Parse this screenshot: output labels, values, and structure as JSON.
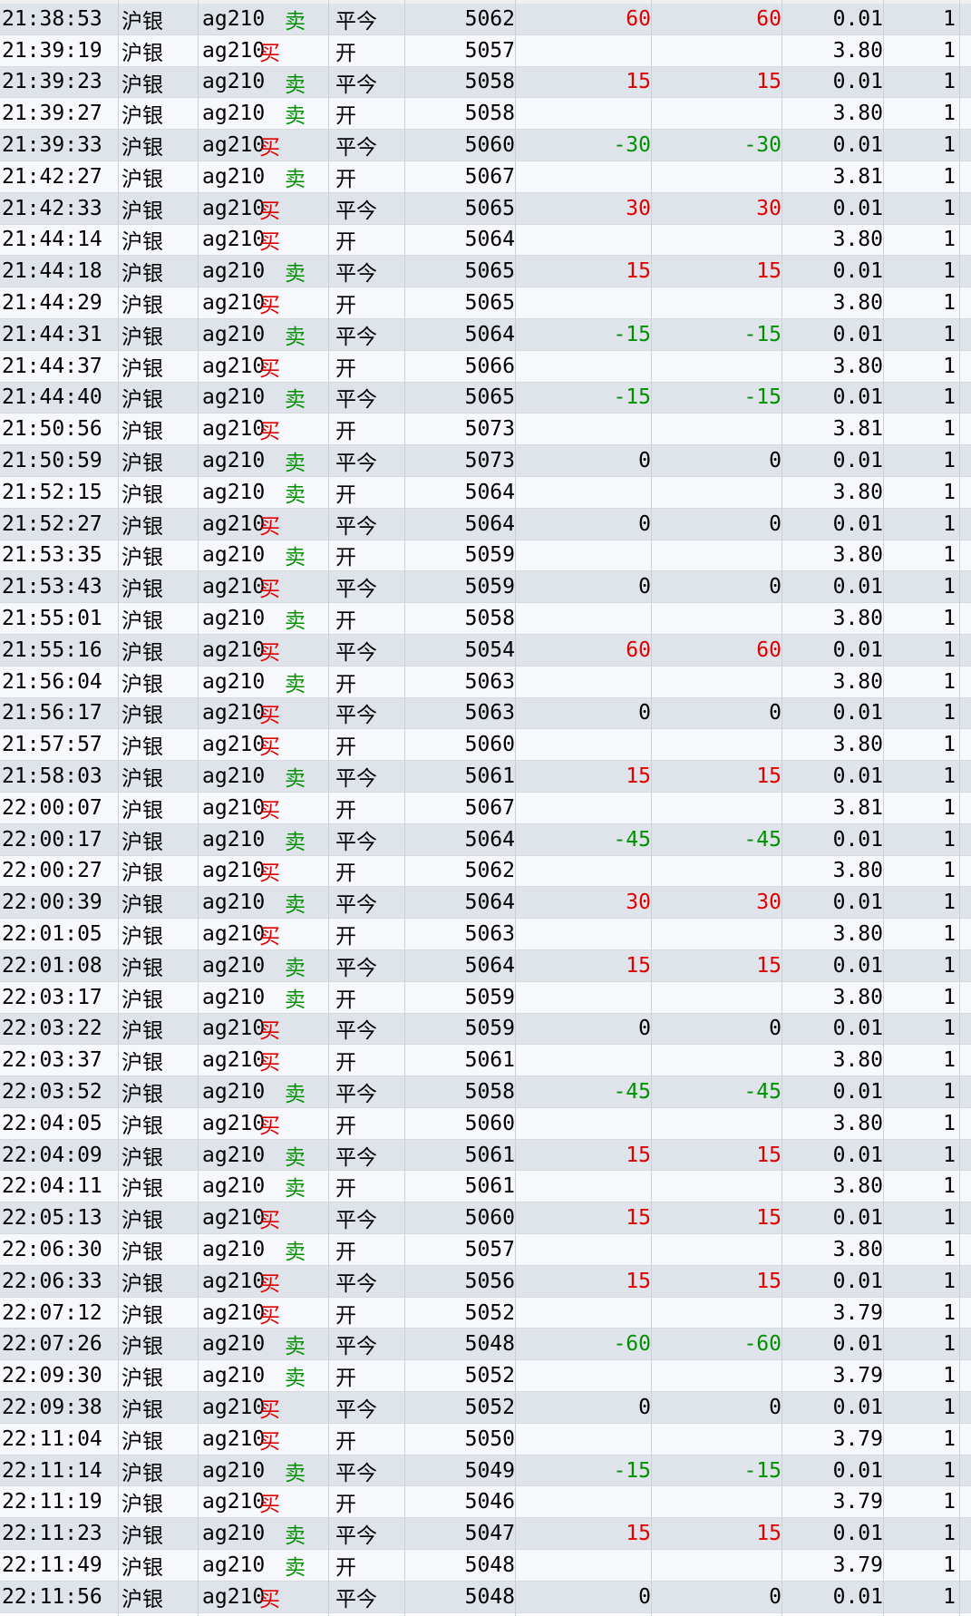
{
  "colors": {
    "buy": "#e00000",
    "sell": "#009000",
    "profit": "#e00000",
    "loss": "#009000"
  },
  "trades": [
    {
      "time": "21:38:53",
      "exchange": "沪银",
      "instrument": "ag210",
      "side": "卖",
      "open_close": "平今",
      "price": "5062",
      "pnl_close": "60",
      "pnl_mark": "60",
      "fee": "0.01",
      "qty": "1"
    },
    {
      "time": "21:39:19",
      "exchange": "沪银",
      "instrument": "ag210",
      "side": "买",
      "open_close": "开",
      "price": "5057",
      "pnl_close": "",
      "pnl_mark": "",
      "fee": "3.80",
      "qty": "1"
    },
    {
      "time": "21:39:23",
      "exchange": "沪银",
      "instrument": "ag210",
      "side": "卖",
      "open_close": "平今",
      "price": "5058",
      "pnl_close": "15",
      "pnl_mark": "15",
      "fee": "0.01",
      "qty": "1"
    },
    {
      "time": "21:39:27",
      "exchange": "沪银",
      "instrument": "ag210",
      "side": "卖",
      "open_close": "开",
      "price": "5058",
      "pnl_close": "",
      "pnl_mark": "",
      "fee": "3.80",
      "qty": "1"
    },
    {
      "time": "21:39:33",
      "exchange": "沪银",
      "instrument": "ag210",
      "side": "买",
      "open_close": "平今",
      "price": "5060",
      "pnl_close": "-30",
      "pnl_mark": "-30",
      "fee": "0.01",
      "qty": "1"
    },
    {
      "time": "21:42:27",
      "exchange": "沪银",
      "instrument": "ag210",
      "side": "卖",
      "open_close": "开",
      "price": "5067",
      "pnl_close": "",
      "pnl_mark": "",
      "fee": "3.81",
      "qty": "1"
    },
    {
      "time": "21:42:33",
      "exchange": "沪银",
      "instrument": "ag210",
      "side": "买",
      "open_close": "平今",
      "price": "5065",
      "pnl_close": "30",
      "pnl_mark": "30",
      "fee": "0.01",
      "qty": "1"
    },
    {
      "time": "21:44:14",
      "exchange": "沪银",
      "instrument": "ag210",
      "side": "买",
      "open_close": "开",
      "price": "5064",
      "pnl_close": "",
      "pnl_mark": "",
      "fee": "3.80",
      "qty": "1"
    },
    {
      "time": "21:44:18",
      "exchange": "沪银",
      "instrument": "ag210",
      "side": "卖",
      "open_close": "平今",
      "price": "5065",
      "pnl_close": "15",
      "pnl_mark": "15",
      "fee": "0.01",
      "qty": "1"
    },
    {
      "time": "21:44:29",
      "exchange": "沪银",
      "instrument": "ag210",
      "side": "买",
      "open_close": "开",
      "price": "5065",
      "pnl_close": "",
      "pnl_mark": "",
      "fee": "3.80",
      "qty": "1"
    },
    {
      "time": "21:44:31",
      "exchange": "沪银",
      "instrument": "ag210",
      "side": "卖",
      "open_close": "平今",
      "price": "5064",
      "pnl_close": "-15",
      "pnl_mark": "-15",
      "fee": "0.01",
      "qty": "1"
    },
    {
      "time": "21:44:37",
      "exchange": "沪银",
      "instrument": "ag210",
      "side": "买",
      "open_close": "开",
      "price": "5066",
      "pnl_close": "",
      "pnl_mark": "",
      "fee": "3.80",
      "qty": "1"
    },
    {
      "time": "21:44:40",
      "exchange": "沪银",
      "instrument": "ag210",
      "side": "卖",
      "open_close": "平今",
      "price": "5065",
      "pnl_close": "-15",
      "pnl_mark": "-15",
      "fee": "0.01",
      "qty": "1"
    },
    {
      "time": "21:50:56",
      "exchange": "沪银",
      "instrument": "ag210",
      "side": "买",
      "open_close": "开",
      "price": "5073",
      "pnl_close": "",
      "pnl_mark": "",
      "fee": "3.81",
      "qty": "1"
    },
    {
      "time": "21:50:59",
      "exchange": "沪银",
      "instrument": "ag210",
      "side": "卖",
      "open_close": "平今",
      "price": "5073",
      "pnl_close": "0",
      "pnl_mark": "0",
      "fee": "0.01",
      "qty": "1"
    },
    {
      "time": "21:52:15",
      "exchange": "沪银",
      "instrument": "ag210",
      "side": "卖",
      "open_close": "开",
      "price": "5064",
      "pnl_close": "",
      "pnl_mark": "",
      "fee": "3.80",
      "qty": "1"
    },
    {
      "time": "21:52:27",
      "exchange": "沪银",
      "instrument": "ag210",
      "side": "买",
      "open_close": "平今",
      "price": "5064",
      "pnl_close": "0",
      "pnl_mark": "0",
      "fee": "0.01",
      "qty": "1"
    },
    {
      "time": "21:53:35",
      "exchange": "沪银",
      "instrument": "ag210",
      "side": "卖",
      "open_close": "开",
      "price": "5059",
      "pnl_close": "",
      "pnl_mark": "",
      "fee": "3.80",
      "qty": "1"
    },
    {
      "time": "21:53:43",
      "exchange": "沪银",
      "instrument": "ag210",
      "side": "买",
      "open_close": "平今",
      "price": "5059",
      "pnl_close": "0",
      "pnl_mark": "0",
      "fee": "0.01",
      "qty": "1"
    },
    {
      "time": "21:55:01",
      "exchange": "沪银",
      "instrument": "ag210",
      "side": "卖",
      "open_close": "开",
      "price": "5058",
      "pnl_close": "",
      "pnl_mark": "",
      "fee": "3.80",
      "qty": "1"
    },
    {
      "time": "21:55:16",
      "exchange": "沪银",
      "instrument": "ag210",
      "side": "买",
      "open_close": "平今",
      "price": "5054",
      "pnl_close": "60",
      "pnl_mark": "60",
      "fee": "0.01",
      "qty": "1"
    },
    {
      "time": "21:56:04",
      "exchange": "沪银",
      "instrument": "ag210",
      "side": "卖",
      "open_close": "开",
      "price": "5063",
      "pnl_close": "",
      "pnl_mark": "",
      "fee": "3.80",
      "qty": "1"
    },
    {
      "time": "21:56:17",
      "exchange": "沪银",
      "instrument": "ag210",
      "side": "买",
      "open_close": "平今",
      "price": "5063",
      "pnl_close": "0",
      "pnl_mark": "0",
      "fee": "0.01",
      "qty": "1"
    },
    {
      "time": "21:57:57",
      "exchange": "沪银",
      "instrument": "ag210",
      "side": "买",
      "open_close": "开",
      "price": "5060",
      "pnl_close": "",
      "pnl_mark": "",
      "fee": "3.80",
      "qty": "1"
    },
    {
      "time": "21:58:03",
      "exchange": "沪银",
      "instrument": "ag210",
      "side": "卖",
      "open_close": "平今",
      "price": "5061",
      "pnl_close": "15",
      "pnl_mark": "15",
      "fee": "0.01",
      "qty": "1"
    },
    {
      "time": "22:00:07",
      "exchange": "沪银",
      "instrument": "ag210",
      "side": "买",
      "open_close": "开",
      "price": "5067",
      "pnl_close": "",
      "pnl_mark": "",
      "fee": "3.81",
      "qty": "1"
    },
    {
      "time": "22:00:17",
      "exchange": "沪银",
      "instrument": "ag210",
      "side": "卖",
      "open_close": "平今",
      "price": "5064",
      "pnl_close": "-45",
      "pnl_mark": "-45",
      "fee": "0.01",
      "qty": "1"
    },
    {
      "time": "22:00:27",
      "exchange": "沪银",
      "instrument": "ag210",
      "side": "买",
      "open_close": "开",
      "price": "5062",
      "pnl_close": "",
      "pnl_mark": "",
      "fee": "3.80",
      "qty": "1"
    },
    {
      "time": "22:00:39",
      "exchange": "沪银",
      "instrument": "ag210",
      "side": "卖",
      "open_close": "平今",
      "price": "5064",
      "pnl_close": "30",
      "pnl_mark": "30",
      "fee": "0.01",
      "qty": "1"
    },
    {
      "time": "22:01:05",
      "exchange": "沪银",
      "instrument": "ag210",
      "side": "买",
      "open_close": "开",
      "price": "5063",
      "pnl_close": "",
      "pnl_mark": "",
      "fee": "3.80",
      "qty": "1"
    },
    {
      "time": "22:01:08",
      "exchange": "沪银",
      "instrument": "ag210",
      "side": "卖",
      "open_close": "平今",
      "price": "5064",
      "pnl_close": "15",
      "pnl_mark": "15",
      "fee": "0.01",
      "qty": "1"
    },
    {
      "time": "22:03:17",
      "exchange": "沪银",
      "instrument": "ag210",
      "side": "卖",
      "open_close": "开",
      "price": "5059",
      "pnl_close": "",
      "pnl_mark": "",
      "fee": "3.80",
      "qty": "1"
    },
    {
      "time": "22:03:22",
      "exchange": "沪银",
      "instrument": "ag210",
      "side": "买",
      "open_close": "平今",
      "price": "5059",
      "pnl_close": "0",
      "pnl_mark": "0",
      "fee": "0.01",
      "qty": "1"
    },
    {
      "time": "22:03:37",
      "exchange": "沪银",
      "instrument": "ag210",
      "side": "买",
      "open_close": "开",
      "price": "5061",
      "pnl_close": "",
      "pnl_mark": "",
      "fee": "3.80",
      "qty": "1"
    },
    {
      "time": "22:03:52",
      "exchange": "沪银",
      "instrument": "ag210",
      "side": "卖",
      "open_close": "平今",
      "price": "5058",
      "pnl_close": "-45",
      "pnl_mark": "-45",
      "fee": "0.01",
      "qty": "1"
    },
    {
      "time": "22:04:05",
      "exchange": "沪银",
      "instrument": "ag210",
      "side": "买",
      "open_close": "开",
      "price": "5060",
      "pnl_close": "",
      "pnl_mark": "",
      "fee": "3.80",
      "qty": "1"
    },
    {
      "time": "22:04:09",
      "exchange": "沪银",
      "instrument": "ag210",
      "side": "卖",
      "open_close": "平今",
      "price": "5061",
      "pnl_close": "15",
      "pnl_mark": "15",
      "fee": "0.01",
      "qty": "1"
    },
    {
      "time": "22:04:11",
      "exchange": "沪银",
      "instrument": "ag210",
      "side": "卖",
      "open_close": "开",
      "price": "5061",
      "pnl_close": "",
      "pnl_mark": "",
      "fee": "3.80",
      "qty": "1"
    },
    {
      "time": "22:05:13",
      "exchange": "沪银",
      "instrument": "ag210",
      "side": "买",
      "open_close": "平今",
      "price": "5060",
      "pnl_close": "15",
      "pnl_mark": "15",
      "fee": "0.01",
      "qty": "1"
    },
    {
      "time": "22:06:30",
      "exchange": "沪银",
      "instrument": "ag210",
      "side": "卖",
      "open_close": "开",
      "price": "5057",
      "pnl_close": "",
      "pnl_mark": "",
      "fee": "3.80",
      "qty": "1"
    },
    {
      "time": "22:06:33",
      "exchange": "沪银",
      "instrument": "ag210",
      "side": "买",
      "open_close": "平今",
      "price": "5056",
      "pnl_close": "15",
      "pnl_mark": "15",
      "fee": "0.01",
      "qty": "1"
    },
    {
      "time": "22:07:12",
      "exchange": "沪银",
      "instrument": "ag210",
      "side": "买",
      "open_close": "开",
      "price": "5052",
      "pnl_close": "",
      "pnl_mark": "",
      "fee": "3.79",
      "qty": "1"
    },
    {
      "time": "22:07:26",
      "exchange": "沪银",
      "instrument": "ag210",
      "side": "卖",
      "open_close": "平今",
      "price": "5048",
      "pnl_close": "-60",
      "pnl_mark": "-60",
      "fee": "0.01",
      "qty": "1"
    },
    {
      "time": "22:09:30",
      "exchange": "沪银",
      "instrument": "ag210",
      "side": "卖",
      "open_close": "开",
      "price": "5052",
      "pnl_close": "",
      "pnl_mark": "",
      "fee": "3.79",
      "qty": "1"
    },
    {
      "time": "22:09:38",
      "exchange": "沪银",
      "instrument": "ag210",
      "side": "买",
      "open_close": "平今",
      "price": "5052",
      "pnl_close": "0",
      "pnl_mark": "0",
      "fee": "0.01",
      "qty": "1"
    },
    {
      "time": "22:11:04",
      "exchange": "沪银",
      "instrument": "ag210",
      "side": "买",
      "open_close": "开",
      "price": "5050",
      "pnl_close": "",
      "pnl_mark": "",
      "fee": "3.79",
      "qty": "1"
    },
    {
      "time": "22:11:14",
      "exchange": "沪银",
      "instrument": "ag210",
      "side": "卖",
      "open_close": "平今",
      "price": "5049",
      "pnl_close": "-15",
      "pnl_mark": "-15",
      "fee": "0.01",
      "qty": "1"
    },
    {
      "time": "22:11:19",
      "exchange": "沪银",
      "instrument": "ag210",
      "side": "买",
      "open_close": "开",
      "price": "5046",
      "pnl_close": "",
      "pnl_mark": "",
      "fee": "3.79",
      "qty": "1"
    },
    {
      "time": "22:11:23",
      "exchange": "沪银",
      "instrument": "ag210",
      "side": "卖",
      "open_close": "平今",
      "price": "5047",
      "pnl_close": "15",
      "pnl_mark": "15",
      "fee": "0.01",
      "qty": "1"
    },
    {
      "time": "22:11:49",
      "exchange": "沪银",
      "instrument": "ag210",
      "side": "卖",
      "open_close": "开",
      "price": "5048",
      "pnl_close": "",
      "pnl_mark": "",
      "fee": "3.79",
      "qty": "1"
    },
    {
      "time": "22:11:56",
      "exchange": "沪银",
      "instrument": "ag210",
      "side": "买",
      "open_close": "平今",
      "price": "5048",
      "pnl_close": "0",
      "pnl_mark": "0",
      "fee": "0.01",
      "qty": "1"
    }
  ]
}
